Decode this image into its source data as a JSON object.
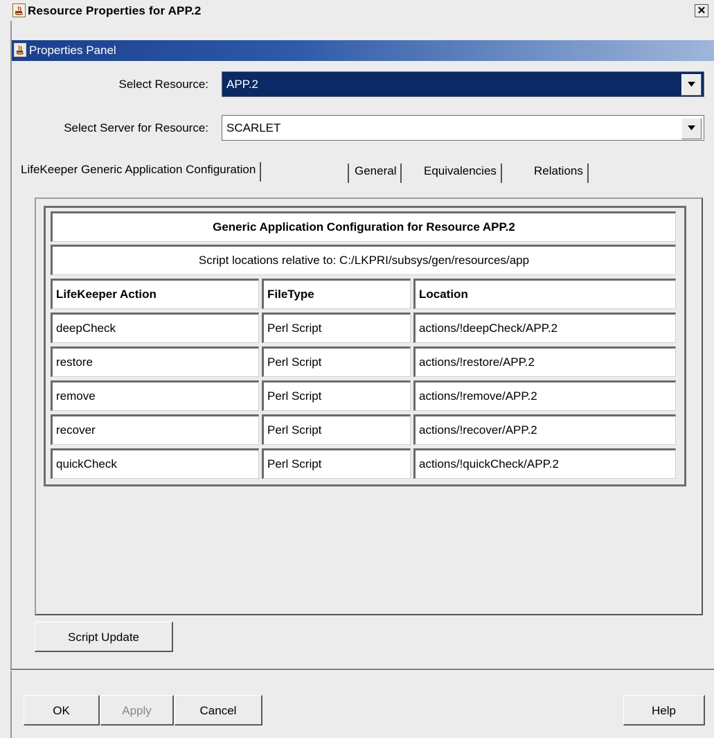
{
  "window": {
    "title": "Resource Properties for APP.2",
    "close_glyph": "✕"
  },
  "panel": {
    "title": "Properties Panel"
  },
  "form": {
    "select_resource_label": "Select Resource:",
    "select_resource_value": "APP.2",
    "select_server_label": "Select Server for Resource:",
    "select_server_value": "SCARLET"
  },
  "tabs": [
    {
      "label": "LifeKeeper Generic Application Configuration",
      "active": true
    },
    {
      "label": "General",
      "active": false
    },
    {
      "label": "Equivalencies",
      "active": false
    },
    {
      "label": "Relations",
      "active": false
    }
  ],
  "config_table": {
    "title": "Generic Application Configuration for Resource APP.2",
    "subtitle": "Script locations relative to: C:/LKPRI/subsys/gen/resources/app",
    "headers": [
      "LifeKeeper Action",
      "FileType",
      "Location"
    ],
    "rows": [
      [
        "deepCheck",
        "Perl Script",
        "actions/!deepCheck/APP.2"
      ],
      [
        "restore",
        "Perl Script",
        "actions/!restore/APP.2"
      ],
      [
        "remove",
        "Perl Script",
        "actions/!remove/APP.2"
      ],
      [
        "recover",
        "Perl Script",
        "actions/!recover/APP.2"
      ],
      [
        "quickCheck",
        "Perl Script",
        "actions/!quickCheck/APP.2"
      ]
    ]
  },
  "buttons": {
    "script_update": "Script Update",
    "ok": "OK",
    "apply": "Apply",
    "cancel": "Cancel",
    "help": "Help"
  },
  "colors": {
    "selected_field_bg": "#0b2965",
    "panel_header_start": "#1a3f8c"
  },
  "icons": [
    "app-window-icon",
    "close-icon",
    "properties-panel-icon",
    "dropdown-arrow-icon"
  ]
}
